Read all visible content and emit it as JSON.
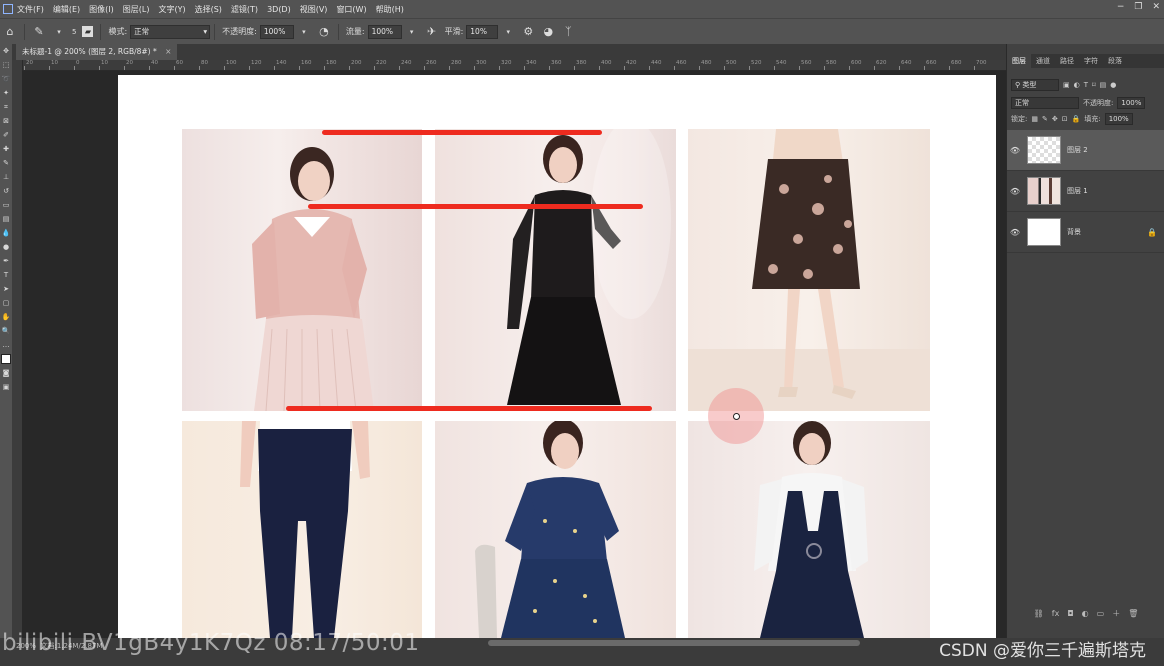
{
  "app": {
    "menu": [
      "文件(F)",
      "编辑(E)",
      "图像(I)",
      "图层(L)",
      "文字(Y)",
      "选择(S)",
      "滤镜(T)",
      "3D(D)",
      "视图(V)",
      "窗口(W)",
      "帮助(H)"
    ],
    "window_controls": [
      "−",
      "❐",
      "✕"
    ]
  },
  "options": {
    "brush_size": "5",
    "mode_label": "模式:",
    "mode_value": "正常",
    "opacity_label": "不透明度:",
    "opacity_value": "100%",
    "flow_label": "流量:",
    "flow_value": "100%",
    "smooth_label": "平滑:",
    "smooth_value": "10%"
  },
  "document": {
    "tab_title": "未标题-1 @ 200% (图层 2, RGB/8#) *",
    "close": "×"
  },
  "ruler": {
    "top_ticks": [
      "20",
      "10",
      "0",
      "10",
      "20",
      "40",
      "60",
      "80",
      "100",
      "120",
      "140",
      "160",
      "180",
      "200",
      "220",
      "240",
      "260",
      "280",
      "300",
      "320",
      "340",
      "360",
      "380",
      "400",
      "420",
      "440",
      "460",
      "480",
      "500",
      "520",
      "540",
      "560",
      "580",
      "600",
      "620",
      "640",
      "660",
      "680",
      "700"
    ]
  },
  "panel": {
    "tabs": [
      "图层",
      "通道",
      "路径",
      "字符",
      "段落"
    ],
    "filter_label": "类型",
    "blend_mode": "正常",
    "opacity_label": "不透明度:",
    "opacity_value": "100%",
    "lock_label": "锁定:",
    "fill_label": "填充:",
    "fill_value": "100%",
    "layers": [
      {
        "name": "图层 2",
        "selected": true
      },
      {
        "name": "图层 1",
        "selected": false
      },
      {
        "name": "背景",
        "selected": false
      }
    ],
    "footer_icons": [
      "link-icon",
      "fx-icon",
      "mask-icon",
      "adjustment-icon",
      "group-icon",
      "new-layer-icon",
      "trash-icon"
    ]
  },
  "status": {
    "zoom": "200%",
    "doc_info": "文档:1.24M/2.87M"
  },
  "watermark": {
    "left": "bilibili BV1gB4y1K7Qz 08:17/50:01",
    "right": "CSDN @爱你三千遍斯塔克"
  },
  "colors": {
    "stroke_red": "#ee2b1f",
    "ui_dark": "#535353",
    "workspace": "#282828"
  }
}
